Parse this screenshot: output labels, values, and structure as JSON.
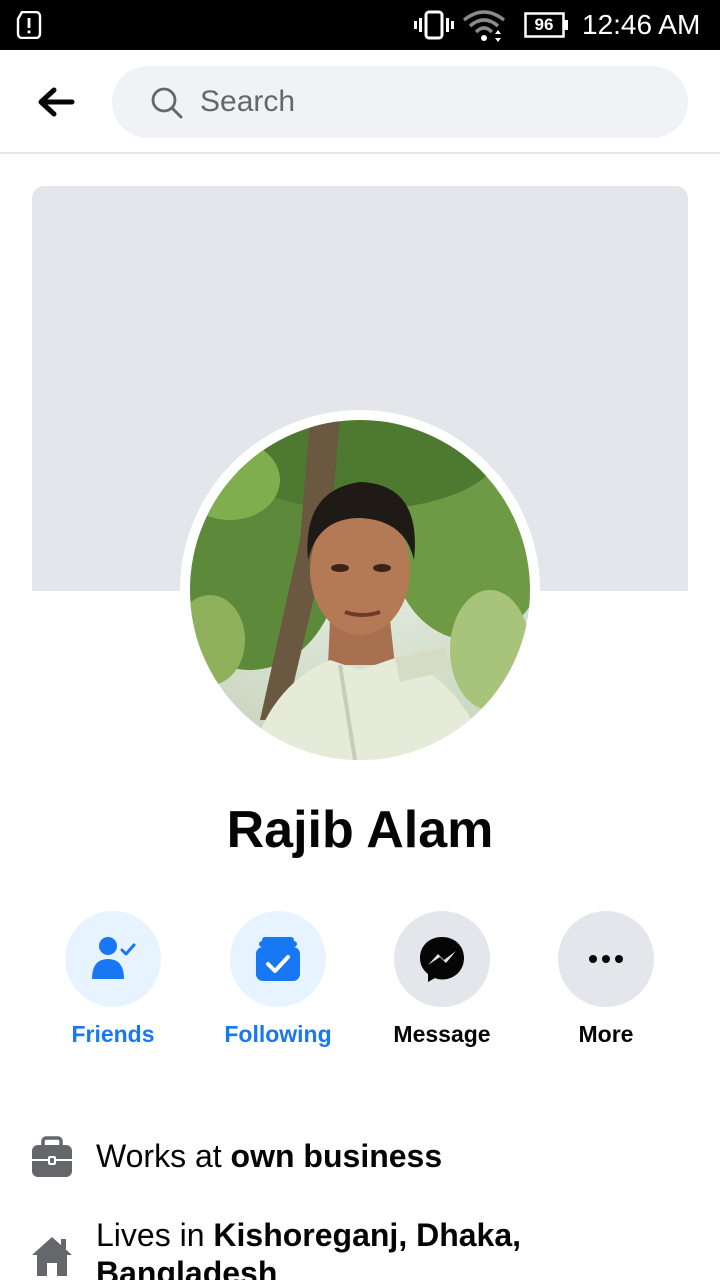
{
  "status_bar": {
    "battery": "96",
    "time": "12:46 AM"
  },
  "search": {
    "placeholder": "Search"
  },
  "profile": {
    "name": "Rajib Alam"
  },
  "actions": [
    {
      "label": "Friends",
      "icon": "friends-check-icon",
      "color": "#1877f2"
    },
    {
      "label": "Following",
      "icon": "following-check-icon",
      "color": "#1877f2"
    },
    {
      "label": "Message",
      "icon": "messenger-icon",
      "color": "#050505"
    },
    {
      "label": "More",
      "icon": "more-dots-icon",
      "color": "#050505"
    }
  ],
  "intro": {
    "work_prefix": "Works at ",
    "work_place": "own business",
    "lives_prefix": "Lives in ",
    "lives_place": "Kishoreganj, Dhaka, Bangladesh"
  },
  "colors": {
    "accent": "#1877f2",
    "accent_bg": "#e7f3ff",
    "neutral_bg": "#e4e6eb"
  }
}
